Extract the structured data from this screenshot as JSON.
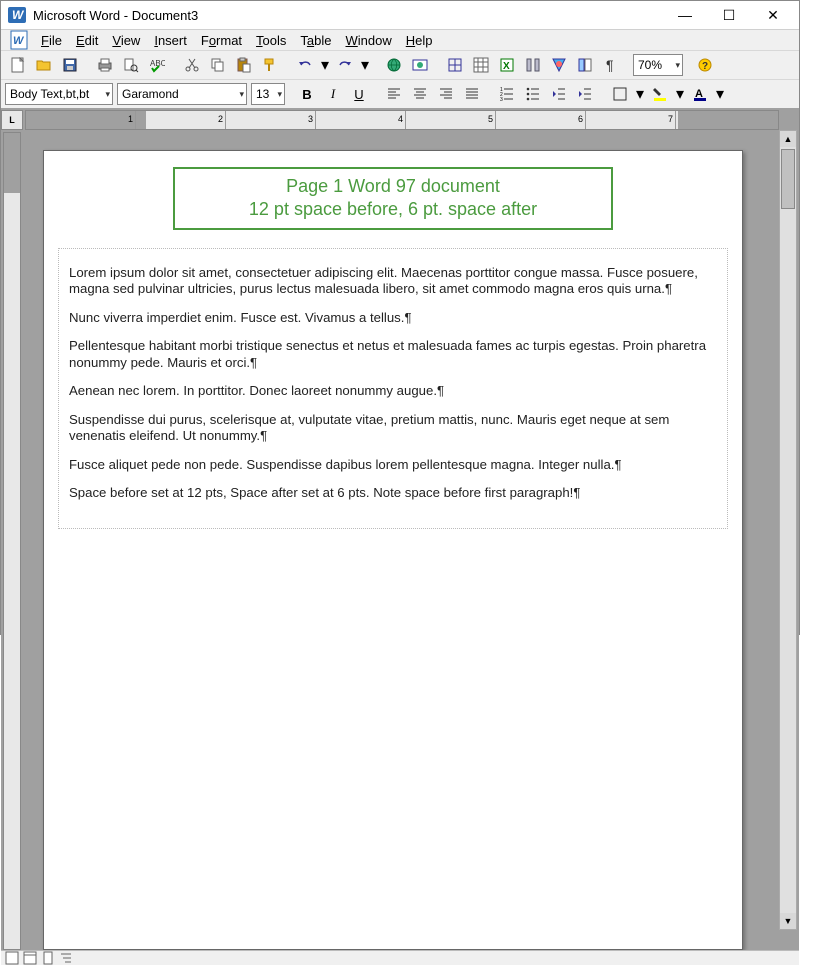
{
  "title": "Microsoft Word - Document3",
  "menus": [
    "File",
    "Edit",
    "View",
    "Insert",
    "Format",
    "Tools",
    "Table",
    "Window",
    "Help"
  ],
  "toolbar1": {
    "zoom": "70%"
  },
  "toolbar2": {
    "style": "Body Text,bt,bt",
    "font": "Garamond",
    "size": "13"
  },
  "ruler_corner": "L",
  "ruler_numbers": [
    "1",
    "2",
    "3",
    "4",
    "5",
    "6",
    "7"
  ],
  "annotation": {
    "line1": "Page 1 Word 97 document",
    "line2": "12 pt space before, 6 pt. space after"
  },
  "paragraphs": [
    "Lorem ipsum dolor sit amet, consectetuer adipiscing elit. Maecenas porttitor congue massa. Fusce posuere, magna sed pulvinar ultricies, purus lectus malesuada libero, sit amet commodo magna eros quis urna.",
    "Nunc viverra imperdiet enim. Fusce est. Vivamus a tellus.",
    "Pellentesque habitant morbi tristique senectus et netus et malesuada fames ac turpis egestas. Proin pharetra nonummy pede. Mauris et orci.",
    "Aenean nec lorem. In porttitor. Donec laoreet nonummy augue.",
    "Suspendisse dui purus, scelerisque at, vulputate vitae, pretium mattis, nunc. Mauris eget neque at sem venenatis eleifend. Ut nonummy.",
    "Fusce aliquet pede non pede. Suspendisse dapibus lorem pellentesque magna. Integer nulla.",
    "Space before set at 12 pts, Space after set at 6 pts. Note space before first paragraph!"
  ],
  "pilcrow": "¶"
}
